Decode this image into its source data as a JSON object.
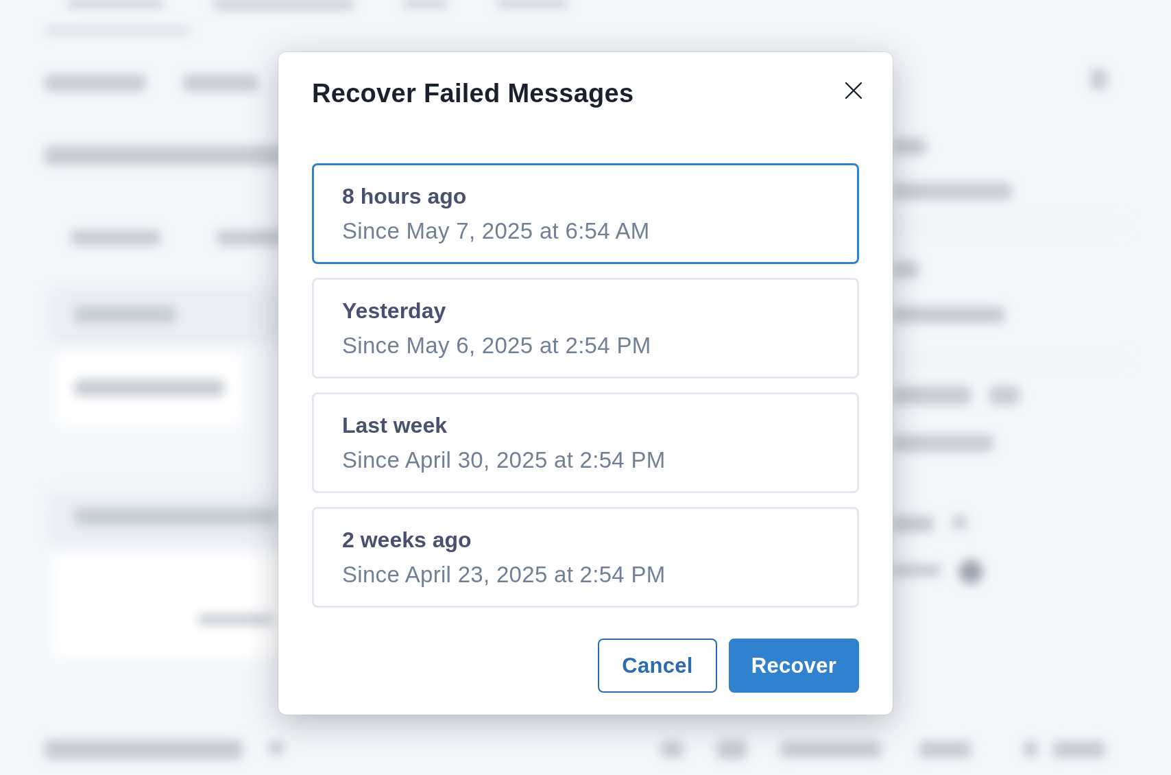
{
  "dialog": {
    "title": "Recover Failed Messages",
    "options": [
      {
        "label": "8 hours ago",
        "detail": "Since May 7, 2025 at 6:54 AM",
        "selected": true
      },
      {
        "label": "Yesterday",
        "detail": "Since May 6, 2025 at 2:54 PM",
        "selected": false
      },
      {
        "label": "Last week",
        "detail": "Since April 30, 2025 at 2:54 PM",
        "selected": false
      },
      {
        "label": "2 weeks ago",
        "detail": "Since April 23, 2025 at 2:54 PM",
        "selected": false
      }
    ],
    "buttons": [
      {
        "label": "Cancel",
        "kind": "secondary"
      },
      {
        "label": "Recover",
        "kind": "primary"
      }
    ]
  }
}
